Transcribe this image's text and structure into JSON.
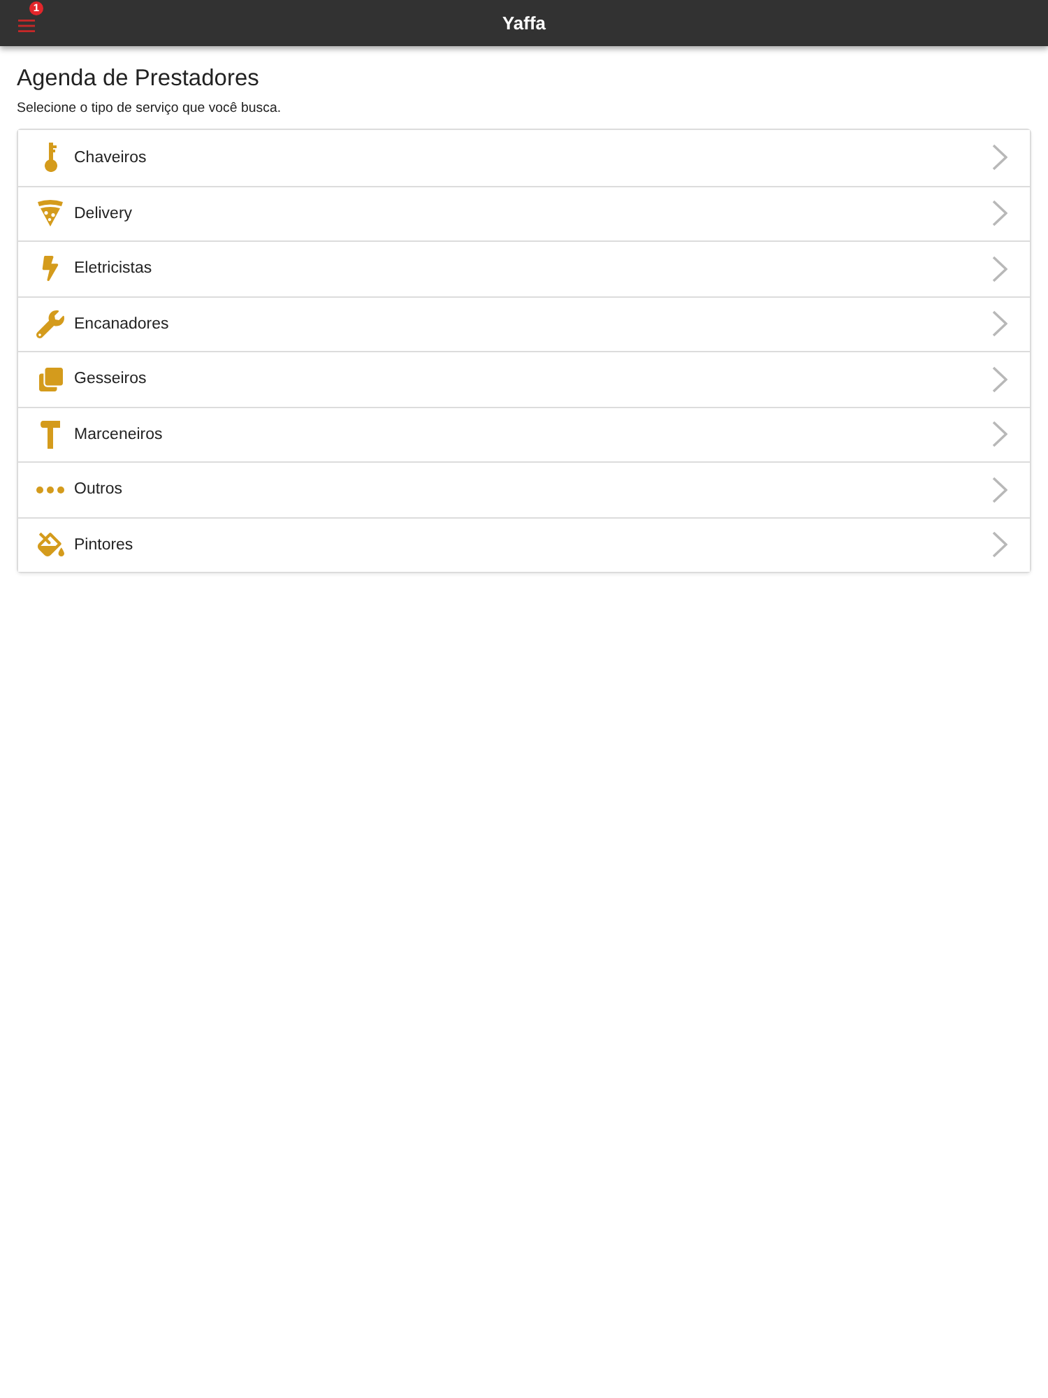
{
  "header": {
    "title": "Yaffa",
    "menu_badge": "1"
  },
  "page": {
    "title": "Agenda de Prestadores",
    "subtitle": "Selecione o tipo de serviço que você busca."
  },
  "services": [
    {
      "label": "Chaveiros"
    },
    {
      "label": "Delivery"
    },
    {
      "label": "Eletricistas"
    },
    {
      "label": "Encanadores"
    },
    {
      "label": "Gesseiros"
    },
    {
      "label": "Marceneiros"
    },
    {
      "label": "Outros"
    },
    {
      "label": "Pintores"
    }
  ]
}
